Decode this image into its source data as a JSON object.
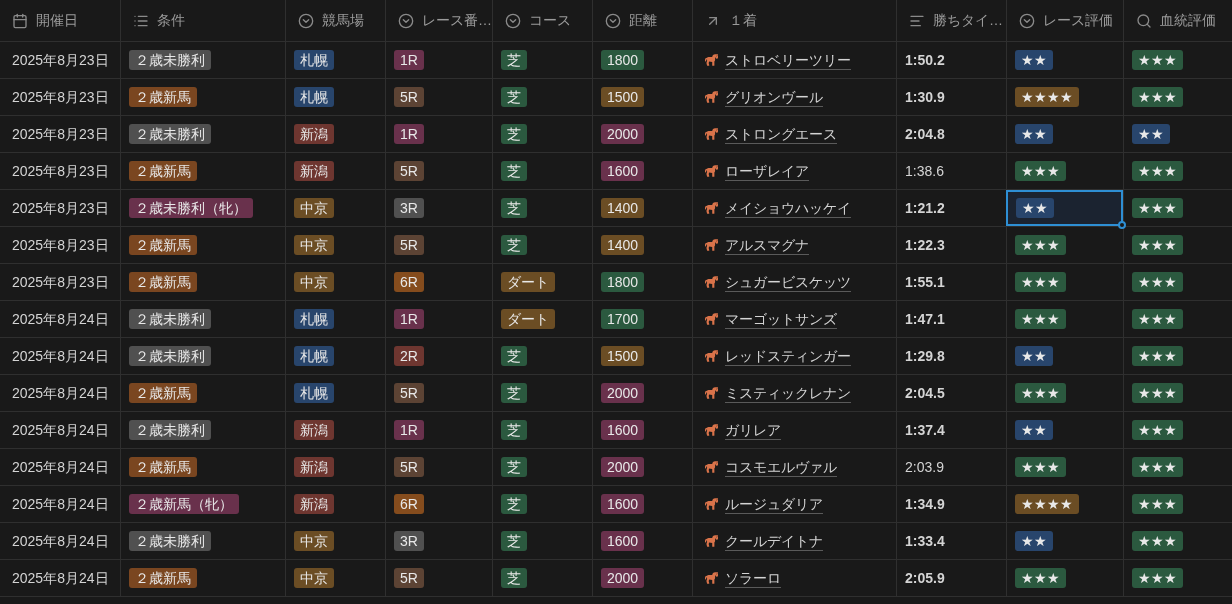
{
  "columns": [
    {
      "label": "開催日",
      "kind": "date"
    },
    {
      "label": "条件",
      "kind": "multi"
    },
    {
      "label": "競馬場",
      "kind": "select"
    },
    {
      "label": "レース番…",
      "kind": "select"
    },
    {
      "label": "コース",
      "kind": "select"
    },
    {
      "label": "距離",
      "kind": "select"
    },
    {
      "label": "１着",
      "kind": "relation"
    },
    {
      "label": "勝ちタイ…",
      "kind": "text"
    },
    {
      "label": "レース評価",
      "kind": "select"
    },
    {
      "label": "血統評価",
      "kind": "search"
    }
  ],
  "rows": [
    {
      "date": "2025年8月23日",
      "condition": {
        "text": "２歳未勝利",
        "color": "#505050"
      },
      "venue": {
        "text": "札幌",
        "color": "#28456c"
      },
      "race_no": {
        "text": "1R",
        "color": "#69314c"
      },
      "course": {
        "text": "芝",
        "color": "#2b593f"
      },
      "distance": {
        "text": "1800",
        "color": "#2b593f"
      },
      "winner": "ストロベリーツリー",
      "time": {
        "text": "1:50.2",
        "bold": true
      },
      "race_rating": {
        "text": "★★",
        "color": "#28456c",
        "selected": false
      },
      "pedigree_rating": {
        "text": "★★★",
        "color": "#2b593f"
      }
    },
    {
      "date": "2025年8月23日",
      "condition": {
        "text": "２歳新馬",
        "color": "#7a4620"
      },
      "venue": {
        "text": "札幌",
        "color": "#28456c"
      },
      "race_no": {
        "text": "5R",
        "color": "#5c4334"
      },
      "course": {
        "text": "芝",
        "color": "#2b593f"
      },
      "distance": {
        "text": "1500",
        "color": "#6b4d24"
      },
      "winner": "グリオンヴール",
      "time": {
        "text": "1:30.9",
        "bold": true
      },
      "race_rating": {
        "text": "★★★★",
        "color": "#6b4d24",
        "selected": false
      },
      "pedigree_rating": {
        "text": "★★★",
        "color": "#2b593f"
      }
    },
    {
      "date": "2025年8月23日",
      "condition": {
        "text": "２歳未勝利",
        "color": "#505050"
      },
      "venue": {
        "text": "新潟",
        "color": "#6e3630"
      },
      "race_no": {
        "text": "1R",
        "color": "#69314c"
      },
      "course": {
        "text": "芝",
        "color": "#2b593f"
      },
      "distance": {
        "text": "2000",
        "color": "#69314c"
      },
      "winner": "ストロングエース",
      "time": {
        "text": "2:04.8",
        "bold": true
      },
      "race_rating": {
        "text": "★★",
        "color": "#28456c",
        "selected": false
      },
      "pedigree_rating": {
        "text": "★★",
        "color": "#28456c"
      }
    },
    {
      "date": "2025年8月23日",
      "condition": {
        "text": "２歳新馬",
        "color": "#7a4620"
      },
      "venue": {
        "text": "新潟",
        "color": "#6e3630"
      },
      "race_no": {
        "text": "5R",
        "color": "#5c4334"
      },
      "course": {
        "text": "芝",
        "color": "#2b593f"
      },
      "distance": {
        "text": "1600",
        "color": "#69314c"
      },
      "winner": "ローザレイア",
      "time": {
        "text": "1:38.6",
        "bold": false
      },
      "race_rating": {
        "text": "★★★",
        "color": "#2b593f",
        "selected": false
      },
      "pedigree_rating": {
        "text": "★★★",
        "color": "#2b593f"
      }
    },
    {
      "date": "2025年8月23日",
      "condition": {
        "text": "２歳未勝利（牝）",
        "color": "#69314c"
      },
      "venue": {
        "text": "中京",
        "color": "#6b4d24"
      },
      "race_no": {
        "text": "3R",
        "color": "#505050"
      },
      "course": {
        "text": "芝",
        "color": "#2b593f"
      },
      "distance": {
        "text": "1400",
        "color": "#6b4d24"
      },
      "winner": "メイショウハッケイ",
      "time": {
        "text": "1:21.2",
        "bold": true
      },
      "race_rating": {
        "text": "★★",
        "color": "#28456c",
        "selected": true
      },
      "pedigree_rating": {
        "text": "★★★",
        "color": "#2b593f"
      }
    },
    {
      "date": "2025年8月23日",
      "condition": {
        "text": "２歳新馬",
        "color": "#7a4620"
      },
      "venue": {
        "text": "中京",
        "color": "#6b4d24"
      },
      "race_no": {
        "text": "5R",
        "color": "#5c4334"
      },
      "course": {
        "text": "芝",
        "color": "#2b593f"
      },
      "distance": {
        "text": "1400",
        "color": "#6b4d24"
      },
      "winner": "アルスマグナ",
      "time": {
        "text": "1:22.3",
        "bold": true
      },
      "race_rating": {
        "text": "★★★",
        "color": "#2b593f",
        "selected": false
      },
      "pedigree_rating": {
        "text": "★★★",
        "color": "#2b593f"
      }
    },
    {
      "date": "2025年8月23日",
      "condition": {
        "text": "２歳新馬",
        "color": "#7a4620"
      },
      "venue": {
        "text": "中京",
        "color": "#6b4d24"
      },
      "race_no": {
        "text": "6R",
        "color": "#854c1d"
      },
      "course": {
        "text": "ダート",
        "color": "#6b4d24"
      },
      "distance": {
        "text": "1800",
        "color": "#2b593f"
      },
      "winner": "シュガービスケッツ",
      "time": {
        "text": "1:55.1",
        "bold": true
      },
      "race_rating": {
        "text": "★★★",
        "color": "#2b593f",
        "selected": false
      },
      "pedigree_rating": {
        "text": "★★★",
        "color": "#2b593f"
      }
    },
    {
      "date": "2025年8月24日",
      "condition": {
        "text": "２歳未勝利",
        "color": "#505050"
      },
      "venue": {
        "text": "札幌",
        "color": "#28456c"
      },
      "race_no": {
        "text": "1R",
        "color": "#69314c"
      },
      "course": {
        "text": "ダート",
        "color": "#6b4d24"
      },
      "distance": {
        "text": "1700",
        "color": "#2b593f"
      },
      "winner": "マーゴットサンズ",
      "time": {
        "text": "1:47.1",
        "bold": true
      },
      "race_rating": {
        "text": "★★★",
        "color": "#2b593f",
        "selected": false
      },
      "pedigree_rating": {
        "text": "★★★",
        "color": "#2b593f"
      }
    },
    {
      "date": "2025年8月24日",
      "condition": {
        "text": "２歳未勝利",
        "color": "#505050"
      },
      "venue": {
        "text": "札幌",
        "color": "#28456c"
      },
      "race_no": {
        "text": "2R",
        "color": "#6e3630"
      },
      "course": {
        "text": "芝",
        "color": "#2b593f"
      },
      "distance": {
        "text": "1500",
        "color": "#6b4d24"
      },
      "winner": "レッドスティンガー",
      "time": {
        "text": "1:29.8",
        "bold": true
      },
      "race_rating": {
        "text": "★★",
        "color": "#28456c",
        "selected": false
      },
      "pedigree_rating": {
        "text": "★★★",
        "color": "#2b593f"
      }
    },
    {
      "date": "2025年8月24日",
      "condition": {
        "text": "２歳新馬",
        "color": "#7a4620"
      },
      "venue": {
        "text": "札幌",
        "color": "#28456c"
      },
      "race_no": {
        "text": "5R",
        "color": "#5c4334"
      },
      "course": {
        "text": "芝",
        "color": "#2b593f"
      },
      "distance": {
        "text": "2000",
        "color": "#69314c"
      },
      "winner": "ミスティックレナン",
      "time": {
        "text": "2:04.5",
        "bold": true
      },
      "race_rating": {
        "text": "★★★",
        "color": "#2b593f",
        "selected": false
      },
      "pedigree_rating": {
        "text": "★★★",
        "color": "#2b593f"
      }
    },
    {
      "date": "2025年8月24日",
      "condition": {
        "text": "２歳未勝利",
        "color": "#505050"
      },
      "venue": {
        "text": "新潟",
        "color": "#6e3630"
      },
      "race_no": {
        "text": "1R",
        "color": "#69314c"
      },
      "course": {
        "text": "芝",
        "color": "#2b593f"
      },
      "distance": {
        "text": "1600",
        "color": "#69314c"
      },
      "winner": "ガリレア",
      "time": {
        "text": "1:37.4",
        "bold": true
      },
      "race_rating": {
        "text": "★★",
        "color": "#28456c",
        "selected": false
      },
      "pedigree_rating": {
        "text": "★★★",
        "color": "#2b593f"
      }
    },
    {
      "date": "2025年8月24日",
      "condition": {
        "text": "２歳新馬",
        "color": "#7a4620"
      },
      "venue": {
        "text": "新潟",
        "color": "#6e3630"
      },
      "race_no": {
        "text": "5R",
        "color": "#5c4334"
      },
      "course": {
        "text": "芝",
        "color": "#2b593f"
      },
      "distance": {
        "text": "2000",
        "color": "#69314c"
      },
      "winner": "コスモエルヴァル",
      "time": {
        "text": "2:03.9",
        "bold": false
      },
      "race_rating": {
        "text": "★★★",
        "color": "#2b593f",
        "selected": false
      },
      "pedigree_rating": {
        "text": "★★★",
        "color": "#2b593f"
      }
    },
    {
      "date": "2025年8月24日",
      "condition": {
        "text": "２歳新馬（牝）",
        "color": "#69314c"
      },
      "venue": {
        "text": "新潟",
        "color": "#6e3630"
      },
      "race_no": {
        "text": "6R",
        "color": "#854c1d"
      },
      "course": {
        "text": "芝",
        "color": "#2b593f"
      },
      "distance": {
        "text": "1600",
        "color": "#69314c"
      },
      "winner": "ルージュダリア",
      "time": {
        "text": "1:34.9",
        "bold": true
      },
      "race_rating": {
        "text": "★★★★",
        "color": "#6b4d24",
        "selected": false
      },
      "pedigree_rating": {
        "text": "★★★",
        "color": "#2b593f"
      }
    },
    {
      "date": "2025年8月24日",
      "condition": {
        "text": "２歳未勝利",
        "color": "#505050"
      },
      "venue": {
        "text": "中京",
        "color": "#6b4d24"
      },
      "race_no": {
        "text": "3R",
        "color": "#505050"
      },
      "course": {
        "text": "芝",
        "color": "#2b593f"
      },
      "distance": {
        "text": "1600",
        "color": "#69314c"
      },
      "winner": "クールデイトナ",
      "time": {
        "text": "1:33.4",
        "bold": true
      },
      "race_rating": {
        "text": "★★",
        "color": "#28456c",
        "selected": false
      },
      "pedigree_rating": {
        "text": "★★★",
        "color": "#2b593f"
      }
    },
    {
      "date": "2025年8月24日",
      "condition": {
        "text": "２歳新馬",
        "color": "#7a4620"
      },
      "venue": {
        "text": "中京",
        "color": "#6b4d24"
      },
      "race_no": {
        "text": "5R",
        "color": "#5c4334"
      },
      "course": {
        "text": "芝",
        "color": "#2b593f"
      },
      "distance": {
        "text": "2000",
        "color": "#69314c"
      },
      "winner": "ソラーロ",
      "time": {
        "text": "2:05.9",
        "bold": true
      },
      "race_rating": {
        "text": "★★★",
        "color": "#2b593f",
        "selected": false
      },
      "pedigree_rating": {
        "text": "★★★",
        "color": "#2b593f"
      }
    }
  ]
}
